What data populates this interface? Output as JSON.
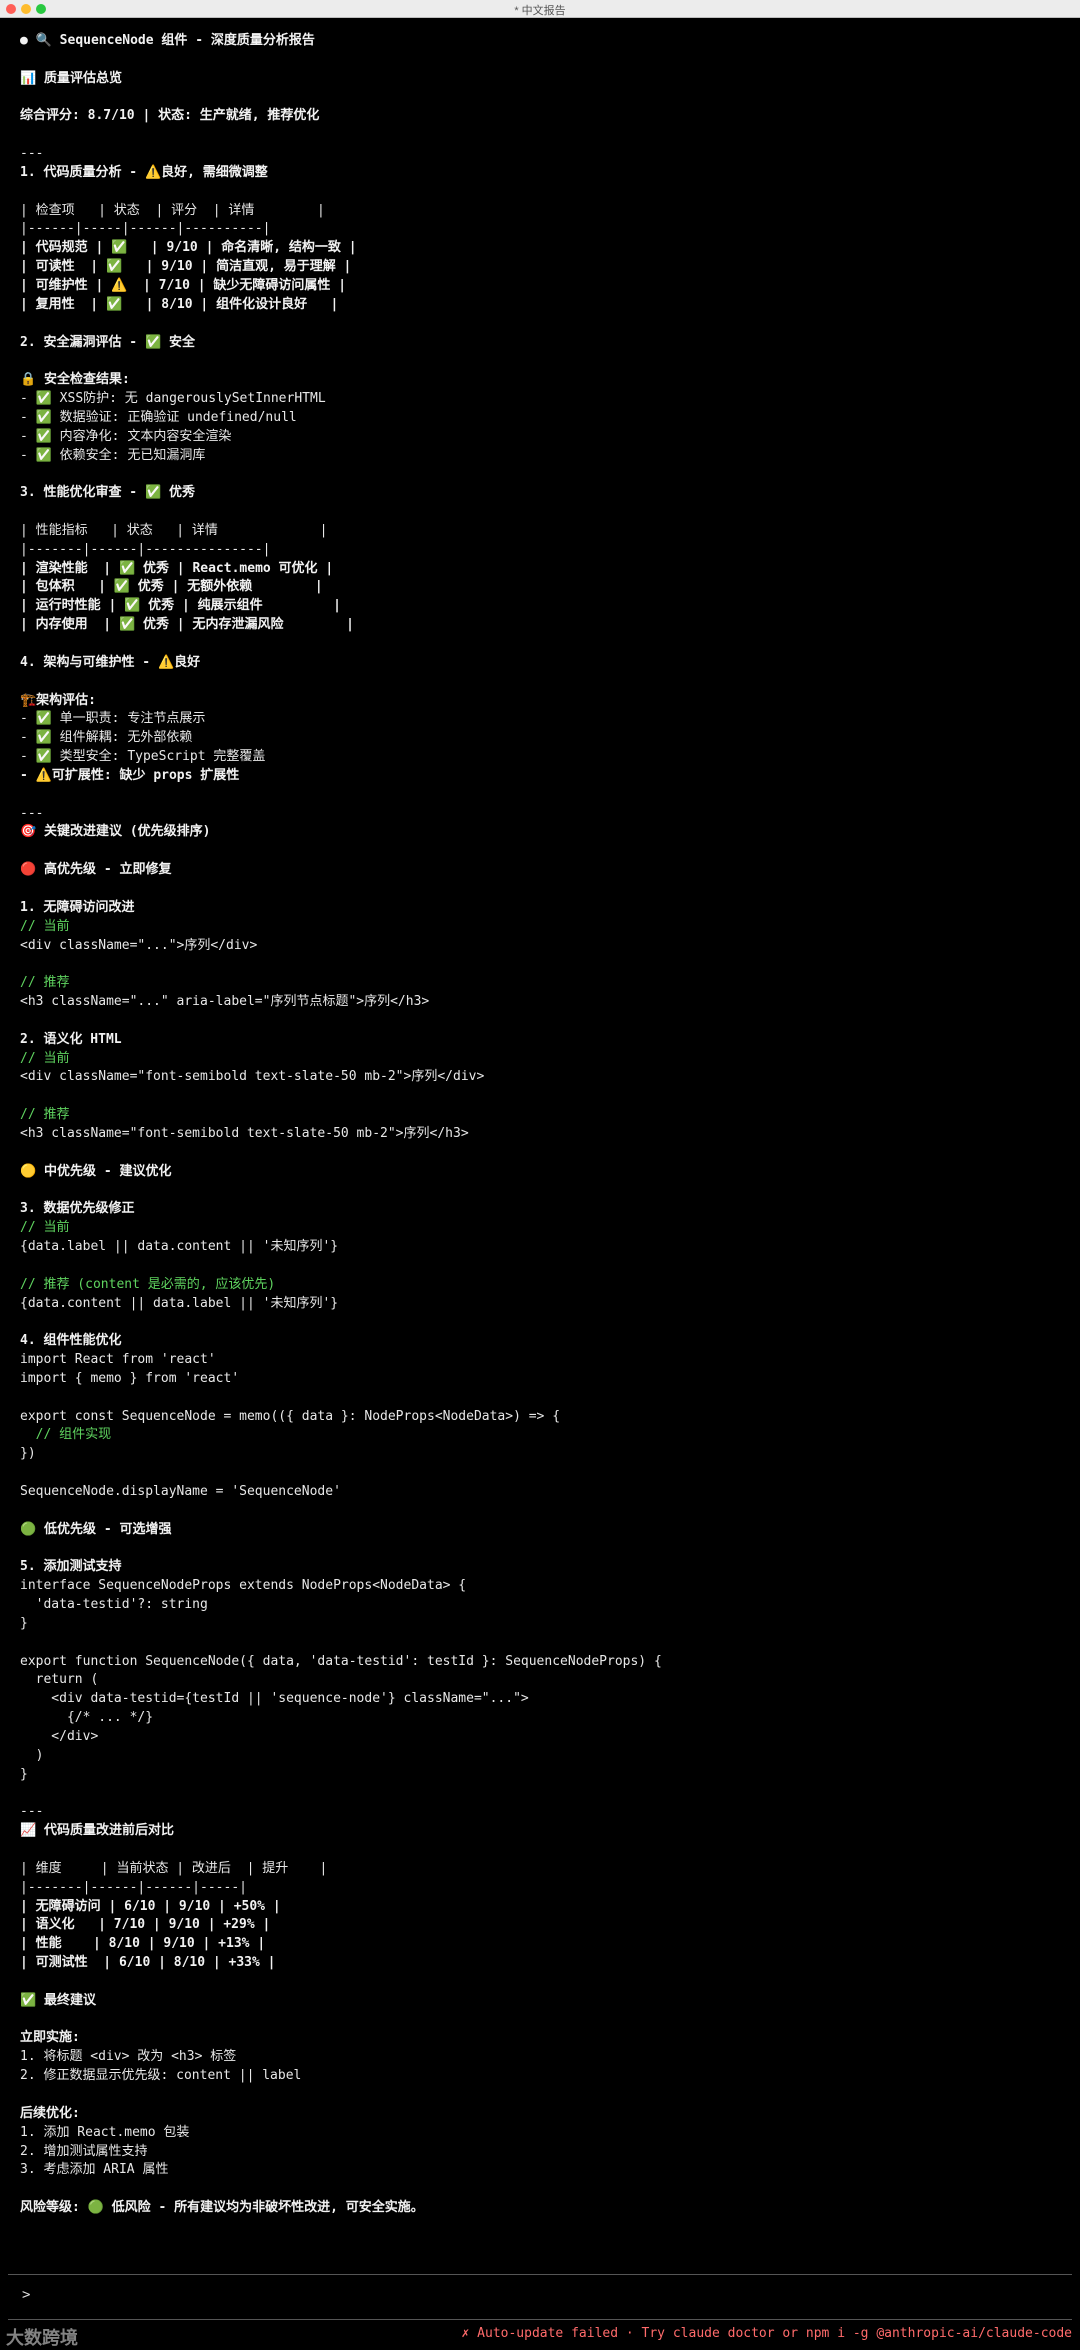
{
  "window": {
    "title": "* 中文报告"
  },
  "report": {
    "lines": [
      {
        "t": "● 🔍 SequenceNode 组件 - 深度质量分析报告",
        "c": "b"
      },
      {
        "t": ""
      },
      {
        "t": "📊 质量评估总览",
        "c": "b"
      },
      {
        "t": ""
      },
      {
        "t": "综合评分: 8.7/10 | 状态: 生产就绪, 推荐优化",
        "c": "b"
      },
      {
        "t": ""
      },
      {
        "t": "---"
      },
      {
        "t": "1. 代码质量分析 - ⚠️良好, 需细微调整",
        "c": "b"
      },
      {
        "t": ""
      },
      {
        "t": "| 检查项   | 状态  | 评分  | 详情        |"
      },
      {
        "t": "|------|-----|------|----------|"
      },
      {
        "t": "| 代码规范 | ✅   | 9/10 | 命名清晰, 结构一致 |",
        "c": "b"
      },
      {
        "t": "| 可读性  | ✅   | 9/10 | 简洁直观, 易于理解 |",
        "c": "b"
      },
      {
        "t": "| 可维护性 | ⚠️  | 7/10 | 缺少无障碍访问属性 |",
        "c": "b"
      },
      {
        "t": "| 复用性  | ✅   | 8/10 | 组件化设计良好   |",
        "c": "b"
      },
      {
        "t": ""
      },
      {
        "t": "2. 安全漏洞评估 - ✅ 安全",
        "c": "b"
      },
      {
        "t": ""
      },
      {
        "t": "🔒 安全检查结果:",
        "c": "b"
      },
      {
        "t": "- ✅ XSS防护: 无 dangerouslySetInnerHTML"
      },
      {
        "t": "- ✅ 数据验证: 正确验证 undefined/null"
      },
      {
        "t": "- ✅ 内容净化: 文本内容安全渲染"
      },
      {
        "t": "- ✅ 依赖安全: 无已知漏洞库"
      },
      {
        "t": ""
      },
      {
        "t": "3. 性能优化审查 - ✅ 优秀",
        "c": "b"
      },
      {
        "t": ""
      },
      {
        "t": "| 性能指标   | 状态   | 详情             |"
      },
      {
        "t": "|-------|------|---------------|"
      },
      {
        "t": "| 渲染性能  | ✅ 优秀 | React.memo 可优化 |",
        "c": "b"
      },
      {
        "t": "| 包体积   | ✅ 优秀 | 无额外依赖        |",
        "c": "b"
      },
      {
        "t": "| 运行时性能 | ✅ 优秀 | 纯展示组件         |",
        "c": "b"
      },
      {
        "t": "| 内存使用  | ✅ 优秀 | 无内存泄漏风险        |",
        "c": "b"
      },
      {
        "t": ""
      },
      {
        "t": "4. 架构与可维护性 - ⚠️良好",
        "c": "b"
      },
      {
        "t": ""
      },
      {
        "t": "🏗️架构评估:",
        "c": "b"
      },
      {
        "t": "- ✅ 单一职责: 专注节点展示"
      },
      {
        "t": "- ✅ 组件解耦: 无外部依赖"
      },
      {
        "t": "- ✅ 类型安全: TypeScript 完整覆盖"
      },
      {
        "t": "- ⚠️可扩展性: 缺少 props 扩展性",
        "c": "b"
      },
      {
        "t": ""
      },
      {
        "t": "---"
      },
      {
        "t": "🎯 关键改进建议 (优先级排序)",
        "c": "b"
      },
      {
        "t": ""
      },
      {
        "t": "🔴 高优先级 - 立即修复",
        "c": "b"
      },
      {
        "t": ""
      },
      {
        "t": "1. 无障碍访问改进",
        "c": "b"
      },
      {
        "t": "// 当前",
        "c": "cmt"
      },
      {
        "t": "<div className=\"...\">序列</div>"
      },
      {
        "t": ""
      },
      {
        "t": "// 推荐",
        "c": "cmt"
      },
      {
        "t": "<h3 className=\"...\" aria-label=\"序列节点标题\">序列</h3>"
      },
      {
        "t": ""
      },
      {
        "t": "2. 语义化 HTML",
        "c": "b"
      },
      {
        "t": "// 当前",
        "c": "cmt"
      },
      {
        "t": "<div className=\"font-semibold text-slate-50 mb-2\">序列</div>"
      },
      {
        "t": ""
      },
      {
        "t": "// 推荐",
        "c": "cmt"
      },
      {
        "t": "<h3 className=\"font-semibold text-slate-50 mb-2\">序列</h3>"
      },
      {
        "t": ""
      },
      {
        "t": "🟡 中优先级 - 建议优化",
        "c": "b"
      },
      {
        "t": ""
      },
      {
        "t": "3. 数据优先级修正",
        "c": "b"
      },
      {
        "t": "// 当前",
        "c": "cmt"
      },
      {
        "t": "{data.label || data.content || '未知序列'}"
      },
      {
        "t": ""
      },
      {
        "t": "// 推荐 (content 是必需的, 应该优先)",
        "c": "cmt"
      },
      {
        "t": "{data.content || data.label || '未知序列'}"
      },
      {
        "t": ""
      },
      {
        "t": "4. 组件性能优化",
        "c": "b"
      },
      {
        "t": "import React from 'react'"
      },
      {
        "t": "import { memo } from 'react'"
      },
      {
        "t": ""
      },
      {
        "t": "export const SequenceNode = memo(({ data }: NodeProps<NodeData>) => {"
      },
      {
        "t": "  // 组件实现",
        "c": "cmt"
      },
      {
        "t": "})"
      },
      {
        "t": ""
      },
      {
        "t": "SequenceNode.displayName = 'SequenceNode'"
      },
      {
        "t": ""
      },
      {
        "t": "🟢 低优先级 - 可选增强",
        "c": "b"
      },
      {
        "t": ""
      },
      {
        "t": "5. 添加测试支持",
        "c": "b"
      },
      {
        "t": "interface SequenceNodeProps extends NodeProps<NodeData> {"
      },
      {
        "t": "  'data-testid'?: string"
      },
      {
        "t": "}"
      },
      {
        "t": ""
      },
      {
        "t": "export function SequenceNode({ data, 'data-testid': testId }: SequenceNodeProps) {"
      },
      {
        "t": "  return ("
      },
      {
        "t": "    <div data-testid={testId || 'sequence-node'} className=\"...\">"
      },
      {
        "t": "      {/* ... */}"
      },
      {
        "t": "    </div>"
      },
      {
        "t": "  )"
      },
      {
        "t": "}"
      },
      {
        "t": ""
      },
      {
        "t": "---"
      },
      {
        "t": "📈 代码质量改进前后对比",
        "c": "b"
      },
      {
        "t": ""
      },
      {
        "t": "| 维度     | 当前状态 | 改进后  | 提升    |"
      },
      {
        "t": "|-------|------|------|-----|"
      },
      {
        "t": "| 无障碍访问 | 6/10 | 9/10 | +50% |",
        "c": "b"
      },
      {
        "t": "| 语义化   | 7/10 | 9/10 | +29% |",
        "c": "b"
      },
      {
        "t": "| 性能    | 8/10 | 9/10 | +13% |",
        "c": "b"
      },
      {
        "t": "| 可测试性  | 6/10 | 8/10 | +33% |",
        "c": "b"
      },
      {
        "t": ""
      },
      {
        "t": "✅ 最终建议",
        "c": "b"
      },
      {
        "t": ""
      },
      {
        "t": "立即实施:",
        "c": "b"
      },
      {
        "t": "1. 将标题 <div> 改为 <h3> 标签"
      },
      {
        "t": "2. 修正数据显示优先级: content || label"
      },
      {
        "t": ""
      },
      {
        "t": "后续优化:",
        "c": "b"
      },
      {
        "t": "1. 添加 React.memo 包装"
      },
      {
        "t": "2. 增加测试属性支持"
      },
      {
        "t": "3. 考虑添加 ARIA 属性"
      },
      {
        "t": ""
      },
      {
        "t": "风险等级: 🟢 低风险 - 所有建议均为非破坏性改进, 可安全实施。",
        "c": "b"
      }
    ]
  },
  "input": {
    "prompt": ">"
  },
  "status": {
    "watermark": "大数跨境",
    "error": "✗ Auto-update failed · Try claude doctor or npm i -g @anthropic-ai/claude-code"
  }
}
